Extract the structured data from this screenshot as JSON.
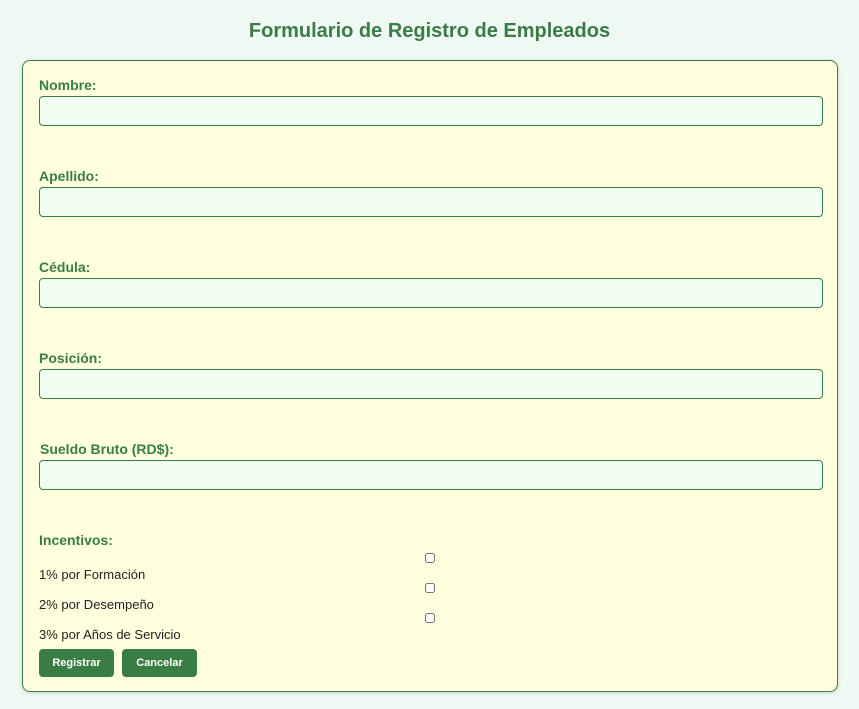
{
  "page": {
    "title": "Formulario de Registro de Empleados"
  },
  "form": {
    "fields": [
      {
        "label": "Nombre:",
        "value": ""
      },
      {
        "label": "Apellido:",
        "value": ""
      },
      {
        "label": "Cédula:",
        "value": ""
      },
      {
        "label": "Posición:",
        "value": ""
      },
      {
        "label": "Sueldo Bruto (RD$):",
        "value": ""
      }
    ],
    "incentives": {
      "label": "Incentivos:",
      "options": [
        {
          "label": "1% por Formación",
          "checked": false
        },
        {
          "label": "2% por Desempeño",
          "checked": false
        },
        {
          "label": "3% por Años de Servicio",
          "checked": false
        }
      ]
    },
    "buttons": {
      "submit_label": "Registrar",
      "cancel_label": "Cancelar"
    }
  },
  "colors": {
    "accent": "#3a7d44",
    "card_background": "#ffffe0",
    "input_background": "#f0fff0",
    "page_background": "#f0f8f4"
  }
}
